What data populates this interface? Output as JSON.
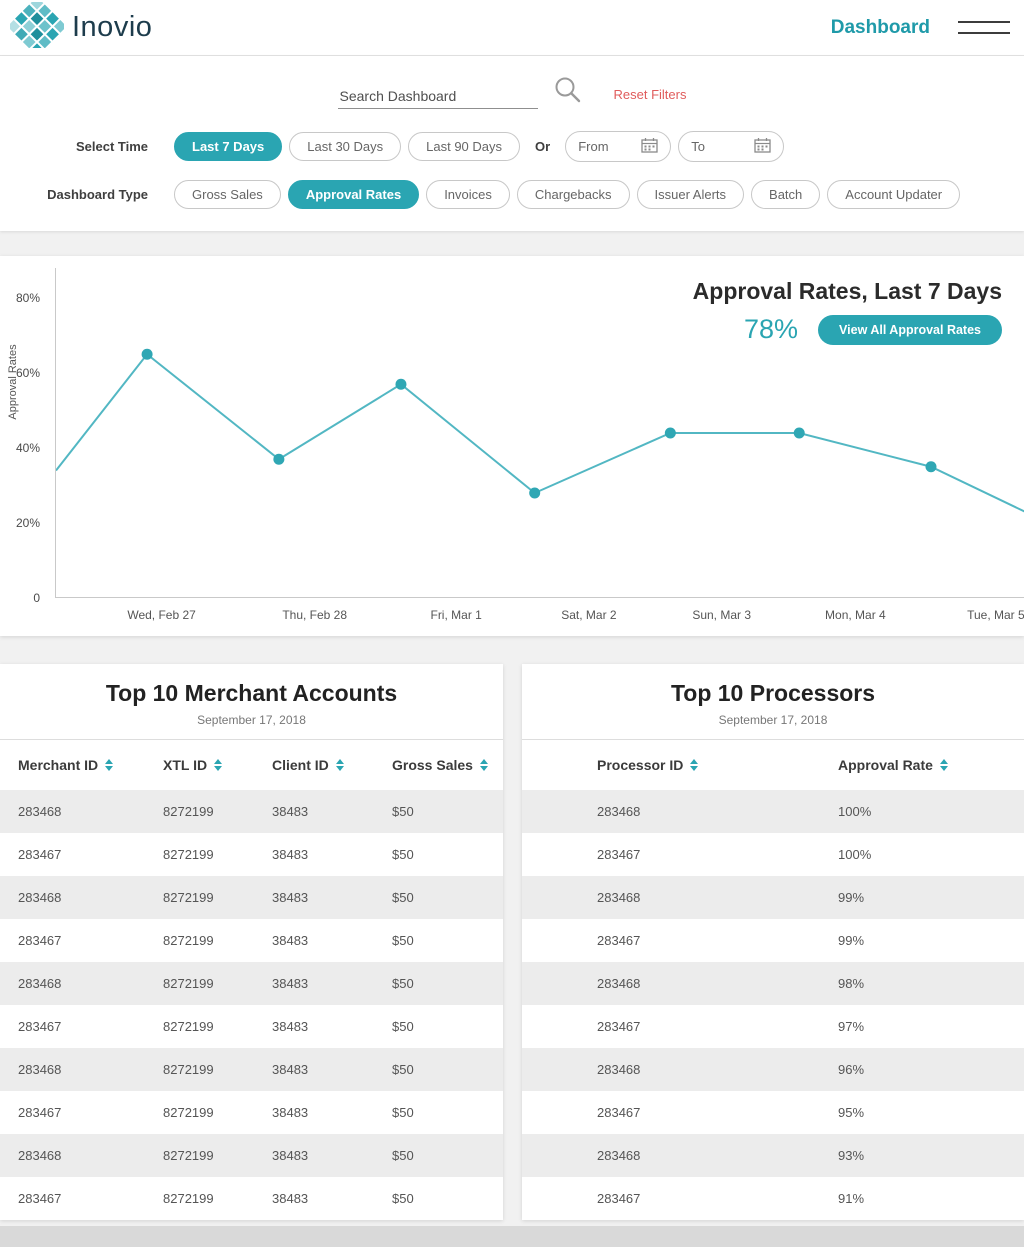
{
  "header": {
    "logo_text": "Inovio",
    "page_title": "Dashboard"
  },
  "filters": {
    "search_placeholder": "Search Dashboard",
    "reset_label": "Reset Filters",
    "select_time_label": "Select Time",
    "or_label": "Or",
    "time_options": [
      {
        "label": "Last 7 Days",
        "active": true
      },
      {
        "label": "Last 30 Days",
        "active": false
      },
      {
        "label": "Last 90 Days",
        "active": false
      }
    ],
    "from_label": "From",
    "to_label": "To",
    "dashboard_type_label": "Dashboard Type",
    "type_options": [
      {
        "label": "Gross Sales",
        "active": false
      },
      {
        "label": "Approval Rates",
        "active": true
      },
      {
        "label": "Invoices",
        "active": false
      },
      {
        "label": "Chargebacks",
        "active": false
      },
      {
        "label": "Issuer Alerts",
        "active": false
      },
      {
        "label": "Batch",
        "active": false
      },
      {
        "label": "Account Updater",
        "active": false
      }
    ]
  },
  "chart": {
    "title": "Approval Rates, Last 7 Days",
    "headline_value": "78%",
    "view_all_label": "View All Approval Rates"
  },
  "chart_data": {
    "type": "line",
    "title": "Approval Rates, Last 7 Days",
    "ylabel": "Approval Rates",
    "ylim": [
      0,
      88
    ],
    "grid": false,
    "line_color": "#52b7c3",
    "marker_color": "#2fa7b4",
    "y_ticks": [
      {
        "value": 0,
        "label": "0"
      },
      {
        "value": 20,
        "label": "20%"
      },
      {
        "value": 40,
        "label": "40%"
      },
      {
        "value": 60,
        "label": "60%"
      },
      {
        "value": 80,
        "label": "80%"
      }
    ],
    "x_tick_labels": [
      {
        "pos": 0.11,
        "label": "Wed, Feb 27"
      },
      {
        "pos": 0.268,
        "label": "Thu, Feb 28"
      },
      {
        "pos": 0.414,
        "label": "Fri, Mar 1"
      },
      {
        "pos": 0.551,
        "label": "Sat, Mar 2"
      },
      {
        "pos": 0.688,
        "label": "Sun, Mar 3"
      },
      {
        "pos": 0.826,
        "label": "Mon, Mar 4"
      },
      {
        "pos": 0.971,
        "label": "Tue, Mar 5"
      }
    ],
    "points": [
      {
        "pos": 0.0,
        "value": 34,
        "marker": false
      },
      {
        "pos": 0.094,
        "value": 65,
        "marker": true
      },
      {
        "pos": 0.23,
        "value": 37,
        "marker": true
      },
      {
        "pos": 0.356,
        "value": 57,
        "marker": true
      },
      {
        "pos": 0.494,
        "value": 28,
        "marker": true
      },
      {
        "pos": 0.634,
        "value": 44,
        "marker": true
      },
      {
        "pos": 0.767,
        "value": 44,
        "marker": true
      },
      {
        "pos": 0.903,
        "value": 35,
        "marker": true
      },
      {
        "pos": 1.0,
        "value": 23,
        "marker": false
      }
    ]
  },
  "tables": {
    "merchants": {
      "title": "Top 10 Merchant Accounts",
      "subtitle": "September 17, 2018",
      "columns": [
        "Merchant ID",
        "XTL ID",
        "Client ID",
        "Gross Sales"
      ],
      "rows": [
        [
          "283468",
          "8272199",
          "38483",
          "$50"
        ],
        [
          "283467",
          "8272199",
          "38483",
          "$50"
        ],
        [
          "283468",
          "8272199",
          "38483",
          "$50"
        ],
        [
          "283467",
          "8272199",
          "38483",
          "$50"
        ],
        [
          "283468",
          "8272199",
          "38483",
          "$50"
        ],
        [
          "283467",
          "8272199",
          "38483",
          "$50"
        ],
        [
          "283468",
          "8272199",
          "38483",
          "$50"
        ],
        [
          "283467",
          "8272199",
          "38483",
          "$50"
        ],
        [
          "283468",
          "8272199",
          "38483",
          "$50"
        ],
        [
          "283467",
          "8272199",
          "38483",
          "$50"
        ]
      ]
    },
    "processors": {
      "title": "Top 10 Processors",
      "subtitle": "September 17, 2018",
      "columns": [
        "Processor ID",
        "Approval Rate"
      ],
      "rows": [
        [
          "283468",
          "100%"
        ],
        [
          "283467",
          "100%"
        ],
        [
          "283468",
          "99%"
        ],
        [
          "283467",
          "99%"
        ],
        [
          "283468",
          "98%"
        ],
        [
          "283467",
          "97%"
        ],
        [
          "283468",
          "96%"
        ],
        [
          "283467",
          "95%"
        ],
        [
          "283468",
          "93%"
        ],
        [
          "283467",
          "91%"
        ]
      ]
    }
  },
  "colors": {
    "accent": "#2aa5b2",
    "reset_link": "#e05c5c",
    "row_alt": "#ececec"
  }
}
